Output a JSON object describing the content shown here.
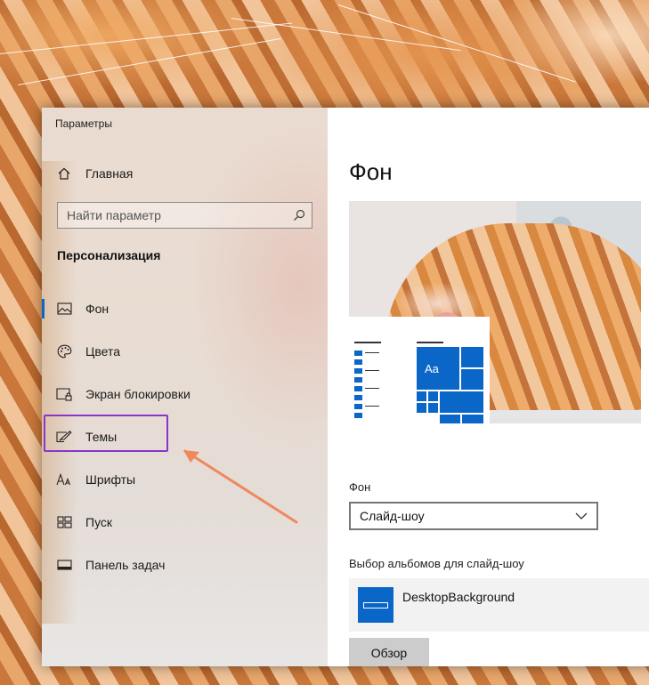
{
  "window": {
    "title": "Параметры"
  },
  "sidebar": {
    "home_label": "Главная",
    "search_placeholder": "Найти параметр",
    "section_title": "Персонализация",
    "items": [
      {
        "label": "Фон",
        "icon": "picture-icon",
        "active": true
      },
      {
        "label": "Цвета",
        "icon": "palette-icon",
        "active": false
      },
      {
        "label": "Экран блокировки",
        "icon": "lock-screen-icon",
        "active": false
      },
      {
        "label": "Темы",
        "icon": "themes-icon",
        "active": false
      },
      {
        "label": "Шрифты",
        "icon": "fonts-icon",
        "active": false
      },
      {
        "label": "Пуск",
        "icon": "start-icon",
        "active": false
      },
      {
        "label": "Панель задач",
        "icon": "taskbar-icon",
        "active": false
      }
    ]
  },
  "content": {
    "page_title": "Фон",
    "preview_tile_text": "Aa",
    "background_label": "Фон",
    "background_value": "Слайд-шоу",
    "albums_label": "Выбор альбомов для слайд-шоу",
    "album_name": "DesktopBackground",
    "browse_label": "Обзор"
  },
  "colors": {
    "accent": "#0a67c8",
    "highlight": "#8a35c9",
    "arrow": "#f0885c"
  }
}
